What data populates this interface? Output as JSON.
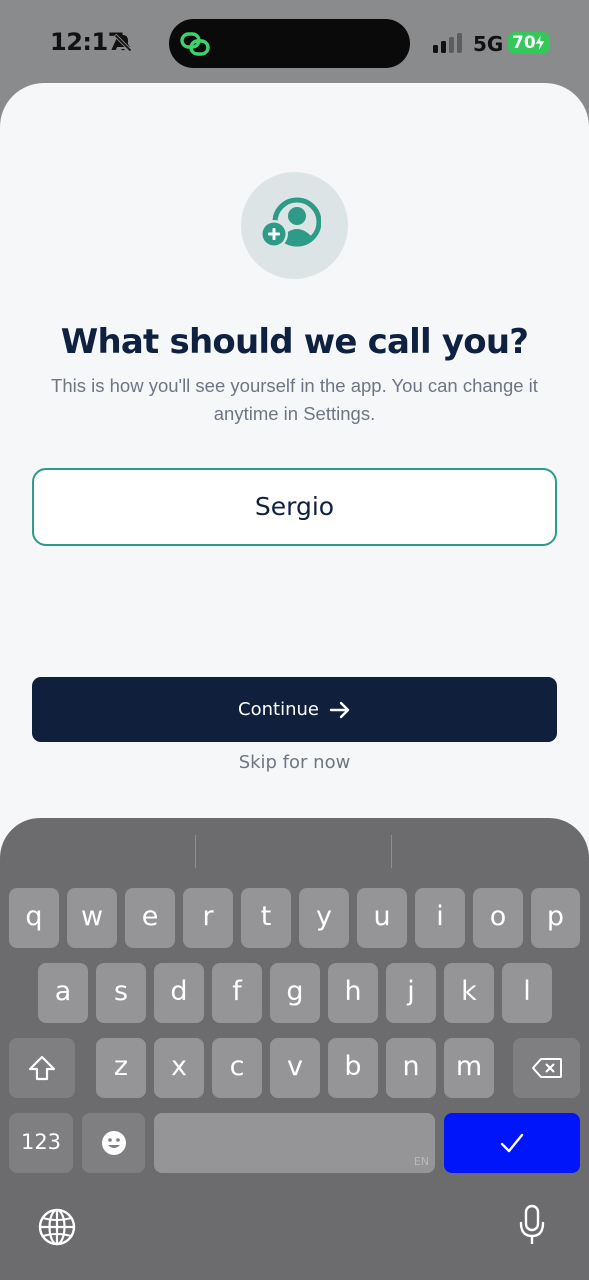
{
  "status_bar": {
    "time": "12:17",
    "network": "5G",
    "battery": "70"
  },
  "icons": {
    "bell": "bell-slash-icon",
    "island_app": "chain-link-icon",
    "profile": "add-user-icon",
    "arrow": "arrow-right-icon",
    "shift": "shift-icon",
    "delete": "backspace-icon",
    "emoji": "emoji-icon",
    "globe": "globe-icon",
    "mic": "microphone-icon",
    "done": "checkmark-icon"
  },
  "colors": {
    "accent": "#2e9a88",
    "primary_button": "#0f1f3c",
    "done_key": "#0015fa",
    "battery": "#34c759"
  },
  "onboarding": {
    "title": "What should we call you?",
    "subtitle": "This is how you'll see yourself in the app. You can change it anytime in Settings.",
    "name_value": "Sergio",
    "continue_label": "Continue",
    "skip_label": "Skip for now"
  },
  "keyboard": {
    "row1": [
      "q",
      "w",
      "e",
      "r",
      "t",
      "y",
      "u",
      "i",
      "o",
      "p"
    ],
    "row2": [
      "a",
      "s",
      "d",
      "f",
      "g",
      "h",
      "j",
      "k",
      "l"
    ],
    "row3": [
      "z",
      "x",
      "c",
      "v",
      "b",
      "n",
      "m"
    ],
    "numbers_label": "123",
    "space_lang": "EN"
  }
}
